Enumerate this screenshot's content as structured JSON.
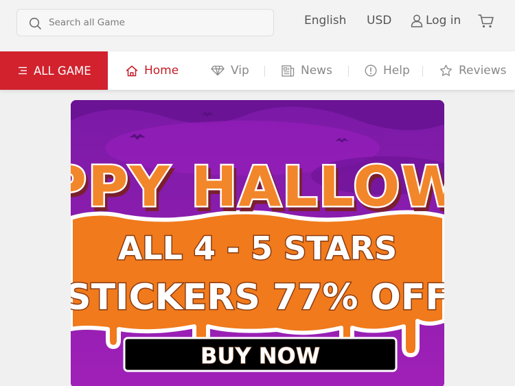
{
  "header": {
    "search": {
      "placeholder": "Search all Game",
      "icon": "search-icon"
    },
    "language": "English",
    "currency": "USD",
    "login_label": "Log in",
    "cart_icon": "cart-icon"
  },
  "nav": {
    "all_game_label": "ALL GAME",
    "items": [
      {
        "label": "Home",
        "icon": "home-icon",
        "active": true
      },
      {
        "label": "Vip",
        "icon": "diamond-icon",
        "active": false
      },
      {
        "label": "News",
        "icon": "news-icon",
        "active": false
      },
      {
        "label": "Help",
        "icon": "help-icon",
        "active": false
      },
      {
        "label": "Reviews",
        "icon": "star-icon",
        "active": false
      }
    ]
  },
  "banner": {
    "headline": "PPY HALLOW",
    "line1": "ALL 4 - 5 STARS",
    "line2": "STICKERS 77% OFF",
    "cta": "BUY NOW"
  },
  "colors": {
    "accent": "#d1222d",
    "active_text": "#c41c26",
    "banner_purple": "#8d1bb0",
    "banner_orange": "#f07a1c"
  }
}
